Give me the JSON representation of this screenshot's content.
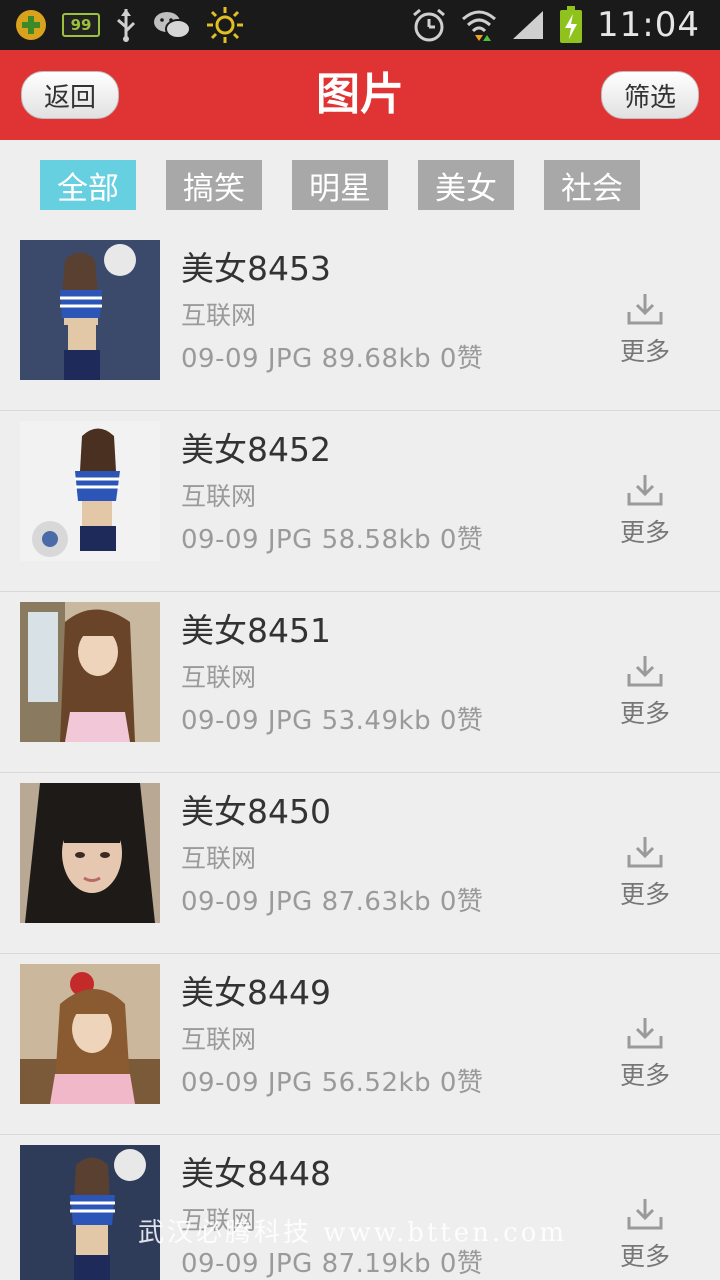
{
  "status_bar": {
    "battery_level_badge": "99",
    "time": "11:04",
    "icons": [
      "app-icon",
      "battery-badge-icon",
      "usb-icon",
      "wechat-icon",
      "sun-icon",
      "alarm-icon",
      "wifi-icon",
      "signal-icon",
      "battery-charging-icon"
    ]
  },
  "header": {
    "title": "图片",
    "back_label": "返回",
    "filter_label": "筛选",
    "bg_color": "#e03333"
  },
  "tabs": [
    {
      "label": "全部",
      "active": true
    },
    {
      "label": "搞笑",
      "active": false
    },
    {
      "label": "明星",
      "active": false
    },
    {
      "label": "美女",
      "active": false
    },
    {
      "label": "社会",
      "active": false
    }
  ],
  "items": [
    {
      "title": "美女8453",
      "source": "互联网",
      "meta": "09-09 JPG 89.68kb 0赞",
      "more": "更多"
    },
    {
      "title": "美女8452",
      "source": "互联网",
      "meta": "09-09 JPG 58.58kb 0赞",
      "more": "更多"
    },
    {
      "title": "美女8451",
      "source": "互联网",
      "meta": "09-09 JPG 53.49kb 0赞",
      "more": "更多"
    },
    {
      "title": "美女8450",
      "source": "互联网",
      "meta": "09-09 JPG 87.63kb 0赞",
      "more": "更多"
    },
    {
      "title": "美女8449",
      "source": "互联网",
      "meta": "09-09 JPG 56.52kb 0赞",
      "more": "更多"
    },
    {
      "title": "美女8448",
      "source": "互联网",
      "meta": "09-09 JPG 87.19kb 0赞",
      "more": "更多"
    }
  ],
  "watermark": "武汉必腾科技 www.btten.com",
  "colors": {
    "tab_active": "#66cfe0",
    "tab_inactive": "#a8a8a8"
  }
}
